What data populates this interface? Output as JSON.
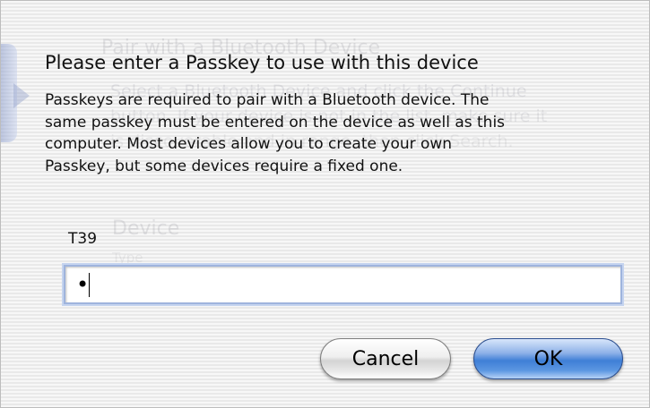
{
  "dialog": {
    "title": "Please enter a Passkey to use with this device",
    "message_lines": [
      "Passkeys are required to pair with a Bluetooth device.  The",
      "same passkey must be entered on the device as well as this",
      "computer. Most devices allow you to create your own",
      "Passkey, but some devices require a fixed one."
    ]
  },
  "device": {
    "label": "T39"
  },
  "passkey_field": {
    "value": "•"
  },
  "buttons": {
    "cancel_label": "Cancel",
    "ok_label": "OK"
  },
  "background_window": {
    "title": "Pair with a Bluetooth Device",
    "lines": [
      "Select a Bluetooth Device and click the Continue",
      "button. If your device is not in the list, make sure it",
      "is discoverable and in range, then click Search."
    ],
    "device_header": "Device",
    "type_header": "Type"
  },
  "colors": {
    "ok_button": "#3f7fd6",
    "focus_ring": "#9fb4dd"
  }
}
